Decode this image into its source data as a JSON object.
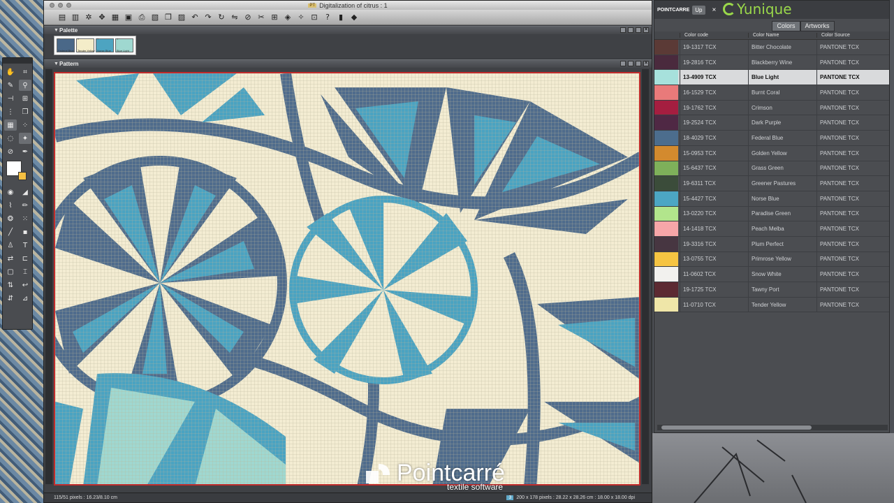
{
  "window": {
    "title": "Digitalization of citrus : 1",
    "badge": "PT"
  },
  "toolbar": {
    "icons": [
      "new-icon",
      "open-icon",
      "settings-icon",
      "move-icon",
      "grid-icon",
      "save-icon",
      "print-icon",
      "export-icon",
      "copy-icon",
      "paste-icon",
      "undo-icon",
      "redo-icon",
      "repeat-icon",
      "mirror-icon",
      "stop-icon",
      "scissors-icon",
      "grid-view-icon",
      "color-icon",
      "transform-icon",
      "image-icon",
      "help-icon",
      "layers-icon",
      "palette-icon"
    ]
  },
  "palette_panel": {
    "title": "Palette",
    "swatches": [
      {
        "label": "Federal Blue",
        "color": "#4a6888"
      },
      {
        "label": "Tender Yellow",
        "color": "#f4edc9"
      },
      {
        "label": "Norse Blue",
        "color": "#4da4c1"
      },
      {
        "label": "Blue Light",
        "color": "#9fd8d0"
      }
    ]
  },
  "pattern_panel": {
    "title": "Pattern"
  },
  "status": {
    "left": "115/51 pixels : 16.23/8.10 cm",
    "count": "3",
    "right": "200 x 178 pixels : 28.22 x 28.26 cm : 18.00 x 18.00 dpi"
  },
  "watermark": {
    "brand": "Pointcarré",
    "sub": "textile software"
  },
  "yunique": {
    "brand_small": "POINTCARRE",
    "up_label": "Up",
    "close_label": "×",
    "logo_text": "Yunique",
    "tabs": [
      "Colors",
      "Artworks"
    ],
    "active_tab": "Colors",
    "columns": [
      "Color code",
      "Color Name",
      "Color Source"
    ],
    "rows": [
      {
        "code": "19-1317 TCX",
        "name": "Bitter Chocolate",
        "source": "PANTONE TCX",
        "color": "#5b3a36"
      },
      {
        "code": "19-2816 TCX",
        "name": "Blackberry Wine",
        "source": "PANTONE TCX",
        "color": "#4a2a3d"
      },
      {
        "code": "13-4909 TCX",
        "name": "Blue Light",
        "source": "PANTONE TCX",
        "color": "#a7e1dc",
        "selected": true
      },
      {
        "code": "16-1529 TCX",
        "name": "Burnt Coral",
        "source": "PANTONE TCX",
        "color": "#e97a7a"
      },
      {
        "code": "19-1762 TCX",
        "name": "Crimson",
        "source": "PANTONE TCX",
        "color": "#a51e40"
      },
      {
        "code": "19-2524 TCX",
        "name": "Dark Purple",
        "source": "PANTONE TCX",
        "color": "#4f2844"
      },
      {
        "code": "18-4029 TCX",
        "name": "Federal Blue",
        "source": "PANTONE TCX",
        "color": "#4c6d8d"
      },
      {
        "code": "15-0953 TCX",
        "name": "Golden Yellow",
        "source": "PANTONE TCX",
        "color": "#d38a2e"
      },
      {
        "code": "15-6437 TCX",
        "name": "Grass Green",
        "source": "PANTONE TCX",
        "color": "#7eb05a"
      },
      {
        "code": "19-6311 TCX",
        "name": "Greener Pastures",
        "source": "PANTONE TCX",
        "color": "#3b4c3a"
      },
      {
        "code": "15-4427 TCX",
        "name": "Norse Blue",
        "source": "PANTONE TCX",
        "color": "#4ca6c4"
      },
      {
        "code": "13-0220 TCX",
        "name": "Paradise Green",
        "source": "PANTONE TCX",
        "color": "#b2e58c"
      },
      {
        "code": "14-1418 TCX",
        "name": "Peach Melba",
        "source": "PANTONE TCX",
        "color": "#f6a6a8"
      },
      {
        "code": "19-3316 TCX",
        "name": "Plum Perfect",
        "source": "PANTONE TCX",
        "color": "#473641"
      },
      {
        "code": "13-0755 TCX",
        "name": "Primrose Yellow",
        "source": "PANTONE TCX",
        "color": "#f6c442"
      },
      {
        "code": "11-0602 TCX",
        "name": "Snow White",
        "source": "PANTONE TCX",
        "color": "#f2f1ee"
      },
      {
        "code": "19-1725 TCX",
        "name": "Tawny Port",
        "source": "PANTONE TCX",
        "color": "#5c2a32"
      },
      {
        "code": "11-0710 TCX",
        "name": "Tender Yellow",
        "source": "PANTONE TCX",
        "color": "#efe6a8"
      }
    ]
  },
  "tools": [
    "hand-icon",
    "crop-icon",
    "eyedropper-icon",
    "zoom-icon",
    "line-icon",
    "grid-icon",
    "repeat-icon",
    "copy-icon",
    "grid-toggle-icon",
    "dots-icon",
    "lasso-icon",
    "magic-wand-icon",
    "no-entry-icon",
    "pen-icon",
    "fill-icon",
    "eraser-icon",
    "brush-icon",
    "pencil-icon",
    "blur-icon",
    "pattern-icon",
    "knife-icon",
    "stamp-icon",
    "stamp2-icon",
    "text-icon",
    "mirror-icon",
    "align-icon",
    "frame-icon",
    "transform-icon",
    "move-icon",
    "rotate-icon",
    "flip-icon",
    "scale-icon"
  ]
}
